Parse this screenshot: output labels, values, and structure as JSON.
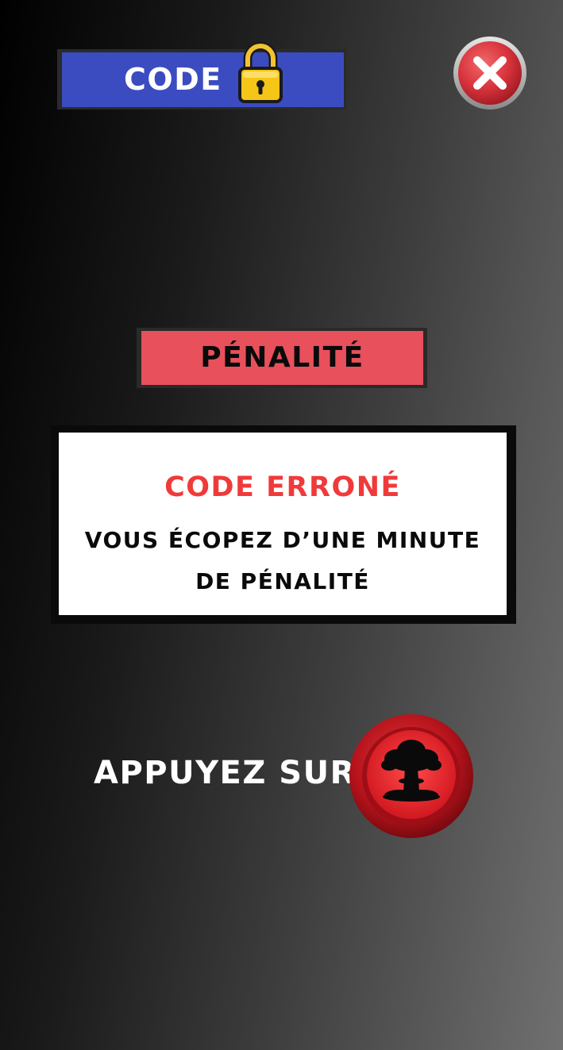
{
  "header": {
    "code_label": "CODE",
    "lock_icon": "lock-icon",
    "close_icon": "close-icon"
  },
  "penalty": {
    "title": "PÉNALITÉ"
  },
  "message": {
    "title": "CODE ERRONÉ",
    "line1": "VOUS ÉCOPEZ D’UNE MINUTE",
    "line2": "DE PÉNALITÉ"
  },
  "prompt": {
    "label": "APPUYEZ SUR",
    "button_icon": "mushroom-cloud-icon"
  },
  "colors": {
    "code_bar": "#3b4cc0",
    "penalty_bar": "#e8505b",
    "error_text": "#f03a3a",
    "close_button": "#d9343d",
    "nuke_button": "#c8161e"
  }
}
